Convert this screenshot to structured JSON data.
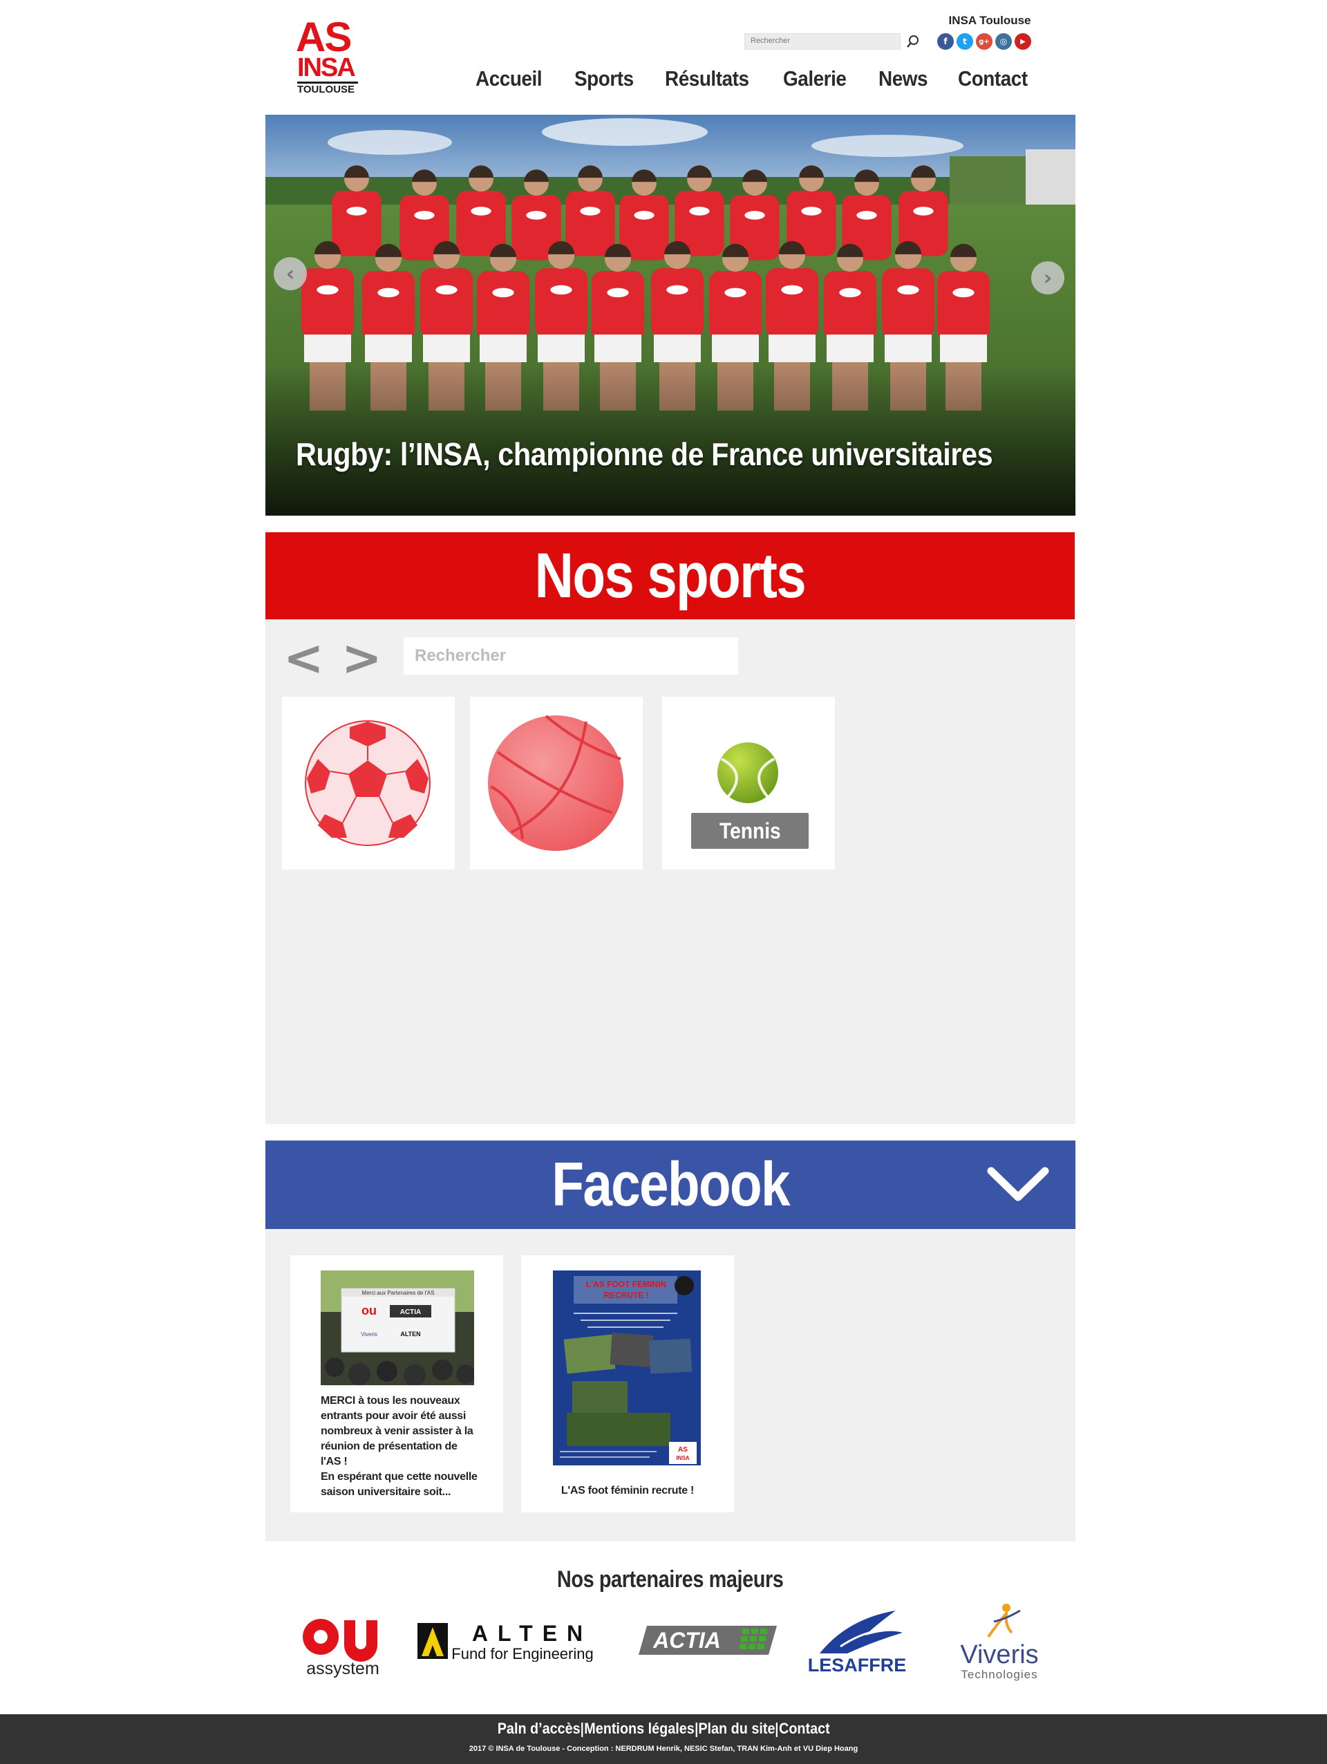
{
  "header": {
    "logo_as": "AS",
    "logo_insa": "INSA",
    "logo_toulouse": "TOULOUSE",
    "search_placeholder": "Rechercher",
    "brand_name": "INSA Toulouse",
    "social": [
      {
        "icon": "facebook-icon",
        "glyph": "f",
        "color": "#3b5998"
      },
      {
        "icon": "twitter-icon",
        "glyph": "t",
        "color": "#1da1f2"
      },
      {
        "icon": "google-plus-icon",
        "glyph": "g+",
        "color": "#dd4b39"
      },
      {
        "icon": "instagram-icon",
        "glyph": "◎",
        "color": "#3f729b"
      },
      {
        "icon": "youtube-icon",
        "glyph": "▶",
        "color": "#cd201f"
      }
    ]
  },
  "nav": {
    "items": [
      "Accueil",
      "Sports",
      "Résultats",
      "Galerie",
      "News",
      "Contact"
    ]
  },
  "hero": {
    "caption": "Rugby: l’INSA, championne de France universitaires",
    "prev": "‹",
    "next": "›"
  },
  "sports": {
    "title": "Nos sports",
    "prev": "<",
    "next": ">",
    "search_placeholder": "Rechercher",
    "cards": [
      {
        "icon": "football-icon",
        "label": ""
      },
      {
        "icon": "basketball-icon",
        "label": ""
      },
      {
        "icon": "tennis-ball-icon",
        "label": "Tennis"
      }
    ]
  },
  "facebook": {
    "title": "Facebook",
    "posts": [
      {
        "image_banner_title": "Merci aux Partenaires de l'AS",
        "text": "MERCI à tous les nouveaux entrants pour avoir été aussi nombreux à venir assister à la réunion de présentation de l'AS !\nEn espérant que cette nouvelle saison universitaire soit..."
      },
      {
        "poster_title": "L'AS FOOT FEMININ RECRUTE !",
        "text": "L'AS foot féminin recrute !"
      }
    ]
  },
  "partners": {
    "title": "Nos partenaires majeurs",
    "logos": [
      {
        "name": "assystem",
        "mark": "ou",
        "color": "#e2121b"
      },
      {
        "name": "ALTEN",
        "sub": "Fund for Engineering",
        "color": "#111111"
      },
      {
        "name": "ACTIA",
        "color": "#7a7a7a"
      },
      {
        "name": "LESAFFRE",
        "color": "#1f3f9a"
      },
      {
        "name": "Viveris",
        "sub": "Technologies",
        "color": "#3b4a8a"
      }
    ]
  },
  "footer": {
    "links": [
      "Paln d’accès",
      "Mentions légales",
      "Plan du site",
      "Contact"
    ],
    "separator": " | ",
    "copyright": "2017 © INSA de Toulouse - Conception : NERDRUM Henrik, NESIC Stefan, TRAN Kim-Anh et VU Diep Hoang"
  }
}
